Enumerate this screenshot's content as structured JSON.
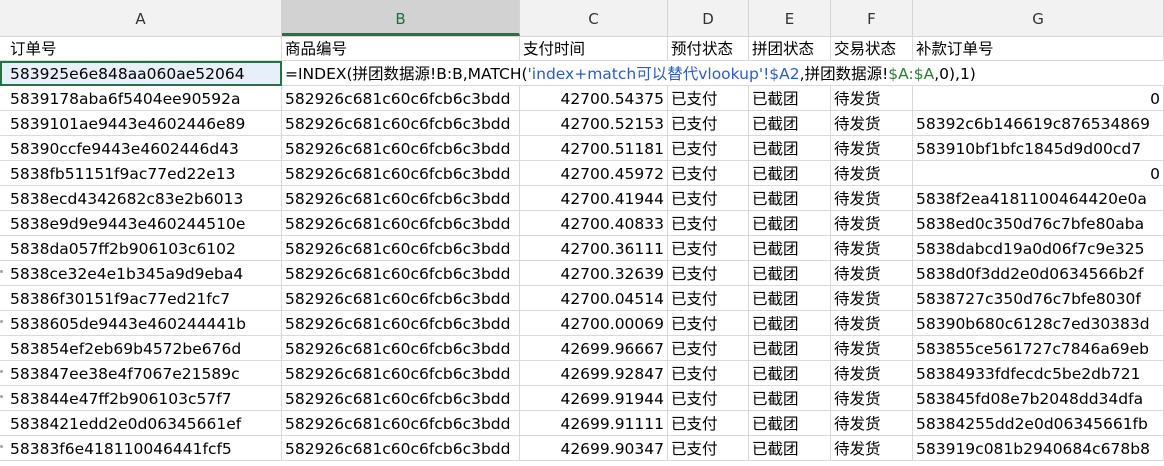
{
  "columns": [
    "A",
    "B",
    "C",
    "D",
    "E",
    "F",
    "G"
  ],
  "selected_column": "B",
  "headers": [
    "订单号",
    "商品编号",
    "支付时间",
    "预付状态",
    "拼团状态",
    "交易状态",
    "补款订单号"
  ],
  "formula_row": {
    "a": "583925e6e848aa060ae52064",
    "formula_prefix": "=INDEX(拼团数据源!B:B,MATCH(",
    "formula_ref": "'index+match可以替代vlookup'!$A2",
    "formula_mid": ",拼团数据源!",
    "formula_range": "$A:$A",
    "formula_suffix": ",0),1)"
  },
  "rows": [
    [
      "5839178aba6f5404ee90592a",
      "582926c681c60c6fcb6c3bdd",
      "42700.54375",
      "已支付",
      "已截团",
      "待发货",
      "0"
    ],
    [
      "5839101ae9443e4602446e89",
      "582926c681c60c6fcb6c3bdd",
      "42700.52153",
      "已支付",
      "已截团",
      "待发货",
      "58392c6b146619c876534869"
    ],
    [
      "58390ccfe9443e4602446d43",
      "582926c681c60c6fcb6c3bdd",
      "42700.51181",
      "已支付",
      "已截团",
      "待发货",
      "583910bf1bfc1845d9d00cd7"
    ],
    [
      "5838fb51151f9ac77ed22e13",
      "582926c681c60c6fcb6c3bdd",
      "42700.45972",
      "已支付",
      "已截团",
      "待发货",
      "0"
    ],
    [
      "5838ecd4342682c83e2b6013",
      "582926c681c60c6fcb6c3bdd",
      "42700.41944",
      "已支付",
      "已截团",
      "待发货",
      "5838f2ea4181100464420e0a"
    ],
    [
      "5838e9d9e9443e460244510e",
      "582926c681c60c6fcb6c3bdd",
      "42700.40833",
      "已支付",
      "已截团",
      "待发货",
      "5838ed0c350d76c7bfe80aba"
    ],
    [
      "5838da057ff2b906103c6102",
      "582926c681c60c6fcb6c3bdd",
      "42700.36111",
      "已支付",
      "已截团",
      "待发货",
      "5838dabcd19a0d06f7c9e325"
    ],
    [
      "5838ce32e4e1b345a9d9eba4",
      "582926c681c60c6fcb6c3bdd",
      "42700.32639",
      "已支付",
      "已截团",
      "待发货",
      "5838d0f3dd2e0d0634566b2f"
    ],
    [
      "58386f30151f9ac77ed21fc7",
      "582926c681c60c6fcb6c3bdd",
      "42700.04514",
      "已支付",
      "已截团",
      "待发货",
      "5838727c350d76c7bfe8030f"
    ],
    [
      "5838605de9443e460244441b",
      "582926c681c60c6fcb6c3bdd",
      "42700.00069",
      "已支付",
      "已截团",
      "待发货",
      "58390b680c6128c7ed30383d"
    ],
    [
      "583854ef2eb69b4572be676d",
      "582926c681c60c6fcb6c3bdd",
      "42699.96667",
      "已支付",
      "已截团",
      "待发货",
      "583855ce561727c7846a69eb"
    ],
    [
      "583847ee38e4f7067e21589c",
      "582926c681c60c6fcb6c3bdd",
      "42699.92847",
      "已支付",
      "已截团",
      "待发货",
      "58384933fdfecdc5be2db721"
    ],
    [
      "583844e47ff2b906103c57f7",
      "582926c681c60c6fcb6c3bdd",
      "42699.91944",
      "已支付",
      "已截团",
      "待发货",
      "583845fd08e7b2048dd34dfa"
    ],
    [
      "5838421edd2e0d06345661ef",
      "582926c681c60c6fcb6c3bdd",
      "42699.91111",
      "已支付",
      "已截团",
      "待发货",
      "58384255dd2e0d06345661fb"
    ],
    [
      "58383f6e418110046441fcf5",
      "582926c681c60c6fcb6c3bdd",
      "42699.90347",
      "已支付",
      "已截团",
      "待发货",
      "583919c081b2940684c678b8"
    ]
  ]
}
